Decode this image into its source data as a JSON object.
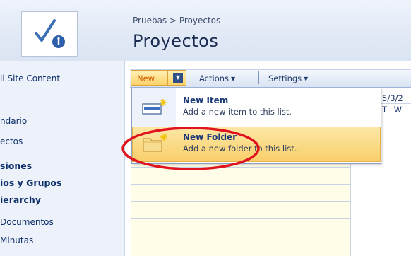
{
  "header": {
    "breadcrumb": "Pruebas > Proyectos",
    "title": "Proyectos"
  },
  "leftnav": {
    "all_site_content": "ll Site Content",
    "items": [
      {
        "label": "ndario",
        "bold": false
      },
      {
        "label": "ectos",
        "bold": false
      },
      {
        "label": "siones",
        "bold": true
      },
      {
        "label": "ios y Grupos",
        "bold": true
      },
      {
        "label": "ierarchy",
        "bold": true
      },
      {
        "label": "Documentos",
        "bold": false
      },
      {
        "label": "Minutas",
        "bold": false
      }
    ]
  },
  "toolbar": {
    "new_label": "New",
    "actions_label": "Actions",
    "settings_label": "Settings"
  },
  "menu": {
    "items": [
      {
        "title": "New Item",
        "description": "Add a new item to this list.",
        "icon": "new-item-icon",
        "highlighted": false
      },
      {
        "title": "New Folder",
        "description": "Add a new folder to this list.",
        "icon": "new-folder-icon",
        "highlighted": true
      }
    ]
  },
  "calendar": {
    "date_fragment": "5/3/2",
    "days_fragment": "T W"
  },
  "colors": {
    "accent_orange": "#d05b00",
    "highlight": "#f9cf6a",
    "annotation_red": "#e0141e",
    "nav_text": "#0e2f6a"
  }
}
